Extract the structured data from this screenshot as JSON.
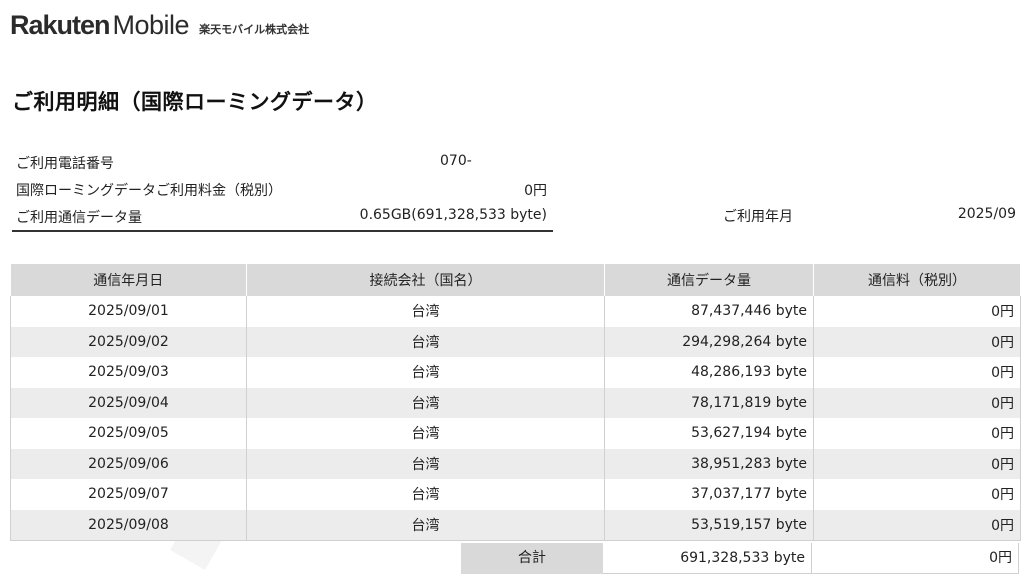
{
  "header": {
    "brand_rakuten": "Rakuten",
    "brand_mobile": "Mobile",
    "company": "楽天モバイル株式会社"
  },
  "title": "ご利用明細（国際ローミングデータ）",
  "summary": {
    "phone_label": "ご利用電話番号",
    "phone_value": "070-",
    "fee_label": "国際ローミングデータご利用料金（税別）",
    "fee_value": "0円",
    "data_label": "ご利用通信データ量",
    "data_value": "0.65GB(691,328,533 byte)"
  },
  "usage_period": {
    "label": "ご利用年月",
    "value": "2025/09"
  },
  "table": {
    "headers": [
      "通信年月日",
      "接続会社（国名）",
      "通信データ量",
      "通信料（税別）"
    ],
    "rows": [
      [
        "2025/09/01",
        "台湾",
        "87,437,446 byte",
        "0円"
      ],
      [
        "2025/09/02",
        "台湾",
        "294,298,264 byte",
        "0円"
      ],
      [
        "2025/09/03",
        "台湾",
        "48,286,193 byte",
        "0円"
      ],
      [
        "2025/09/04",
        "台湾",
        "78,171,819 byte",
        "0円"
      ],
      [
        "2025/09/05",
        "台湾",
        "53,627,194 byte",
        "0円"
      ],
      [
        "2025/09/06",
        "台湾",
        "38,951,283 byte",
        "0円"
      ],
      [
        "2025/09/07",
        "台湾",
        "37,037,177 byte",
        "0円"
      ],
      [
        "2025/09/08",
        "台湾",
        "53,519,157 byte",
        "0円"
      ]
    ]
  },
  "total": {
    "label": "合計",
    "data": "691,328,533 byte",
    "fee": "0円"
  },
  "colors": {
    "header_bg": "#d9d9d9",
    "stripe_bg": "#ececec",
    "text": "#222222"
  }
}
